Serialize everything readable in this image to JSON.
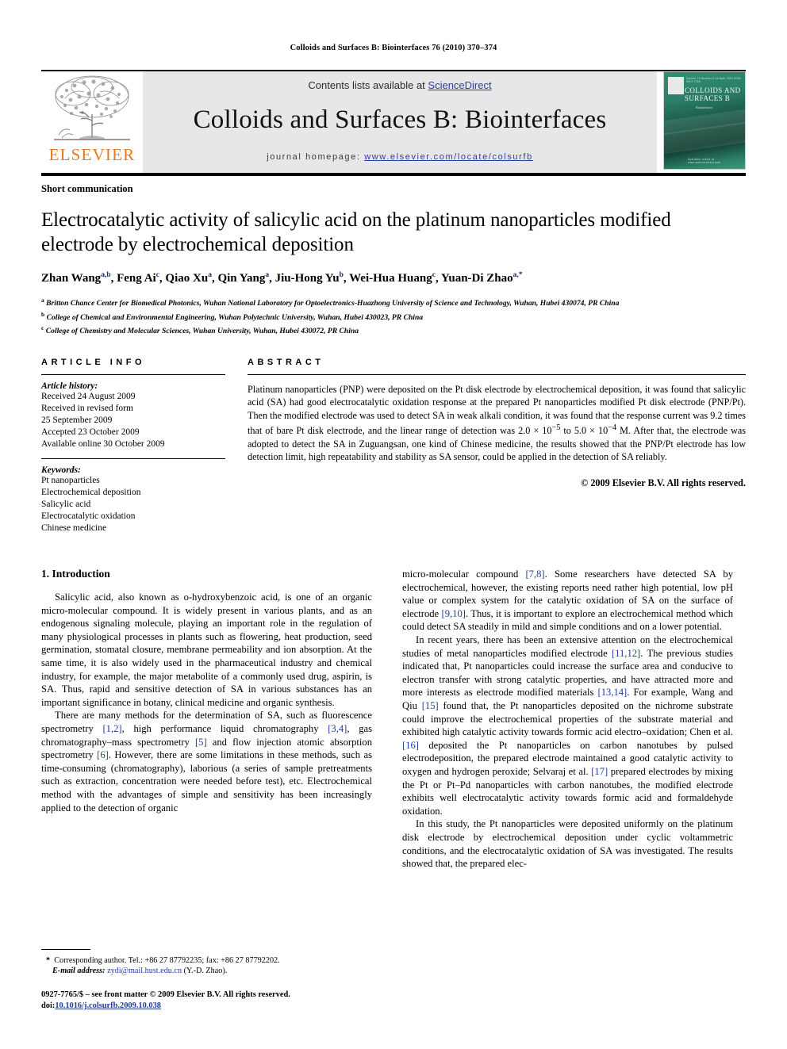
{
  "running_head": "Colloids and Surfaces B: Biointerfaces 76 (2010) 370–374",
  "masthead": {
    "contents_prefix": "Contents lists available at ",
    "sciencedirect": "ScienceDirect",
    "journal_title": "Colloids and Surfaces B: Biointerfaces",
    "homepage_prefix": "journal homepage: ",
    "homepage_url": "www.elsevier.com/locate/colsurfb",
    "publisher_wordmark": "ELSEVIER",
    "cover": {
      "top_line": "Volume 76  Number 2  15 April 2010  ISSN 0927-7765",
      "title": "COLLOIDS AND SURFACES B",
      "subtitle": "Biointerfaces",
      "footer": "Available online at www.sciencedirect.com"
    },
    "colors": {
      "link": "#2b3f9e",
      "elsevier_orange": "#E87722",
      "cover_green": "#2f8f74",
      "masthead_bg": "#e7e7e9"
    }
  },
  "article": {
    "type_label": "Short communication",
    "title": "Electrocatalytic activity of salicylic acid on the platinum nanoparticles modified electrode by electrochemical deposition",
    "authors_html": "Zhan Wang<sup>a,b</sup>, Feng Ai<sup>c</sup>, Qiao Xu<sup>a</sup>, Qin Yang<sup>a</sup>, Jiu-Hong Yu<sup>b</sup>, Wei-Hua Huang<sup>c</sup>, Yuan-Di Zhao<sup>a,</sup><sup>*</sup>",
    "affiliations": [
      "Britton Chance Center for Biomedical Photonics, Wuhan National Laboratory for Optoelectronics-Huazhong University of Science and Technology, Wuhan, Hubei 430074, PR China",
      "College of Chemical and Environmental Engineering, Wuhan Polytechnic University, Wuhan, Hubei 430023, PR China",
      "College of Chemistry and Molecular Sciences, Wuhan University, Wuhan, Hubei 430072, PR China"
    ],
    "affiliation_marks": [
      "a",
      "b",
      "c"
    ]
  },
  "info": {
    "label": "ARTICLE INFO",
    "history_head": "Article history:",
    "history_lines": [
      "Received 24 August 2009",
      "Received in revised form",
      "25 September 2009",
      "Accepted 23 October 2009",
      "Available online 30 October 2009"
    ],
    "keywords_head": "Keywords:",
    "keywords": [
      "Pt nanoparticles",
      "Electrochemical deposition",
      "Salicylic acid",
      "Electrocatalytic oxidation",
      "Chinese medicine"
    ]
  },
  "abstract": {
    "label": "ABSTRACT",
    "text_html": "Platinum nanoparticles (PNP) were deposited on the Pt disk electrode by electrochemical deposition, it was found that salicylic acid (SA) had good electrocatalytic oxidation response at the prepared Pt nanoparticles modified Pt disk electrode (PNP/Pt). Then the modified electrode was used to detect SA in weak alkali condition, it was found that the response current was 9.2 times that of bare Pt disk electrode, and the linear range of detection was 2.0 &times; 10<sup>&minus;5</sup> to 5.0 &times; 10<sup>&minus;4</sup> M. After that, the electrode was adopted to detect the SA in Zuguangsan, one kind of Chinese medicine, the results showed that the PNP/Pt electrode has low detection limit, high repeatability and stability as SA sensor, could be applied in the detection of SA reliably.",
    "copyright": "© 2009 Elsevier B.V. All rights reserved."
  },
  "body": {
    "section_number_title": "1. Introduction",
    "left_paragraphs_html": [
      "Salicylic acid, also known as o-hydroxybenzoic acid, is one of an organic micro-molecular compound. It is widely present in various plants, and as an endogenous signaling molecule, playing an important role in the regulation of many physiological processes in plants such as flowering, heat production, seed germination, stomatal closure, membrane permeability and ion absorption. At the same time, it is also widely used in the pharmaceutical industry and chemical industry, for example, the major metabolite of a commonly used drug, aspirin, is SA. Thus, rapid and sensitive detection of SA in various substances has an important significance in botany, clinical medicine and organic synthesis.",
      "There are many methods for the determination of SA, such as fluorescence spectrometry <span class=\"ref\">[1,2]</span>, high performance liquid chromatography <span class=\"ref\">[3,4]</span>, gas chromatography&ndash;mass spectrometry <span class=\"ref\">[5]</span> and flow injection atomic absorption spectrometry <span class=\"ref\">[6]</span>. However, there are some limitations in these methods, such as time-consuming (chromatography), laborious (a series of sample pretreatments such as extraction, concentration were needed before test), etc. Electrochemical method with the advantages of simple and sensitivity has been increasingly applied to the detection of organic"
    ],
    "right_paragraphs_html": [
      "micro-molecular compound <span class=\"ref\">[7,8]</span>. Some researchers have detected SA by electrochemical, however, the existing reports need rather high potential, low pH value or complex system for the catalytic oxidation of SA on the surface of electrode <span class=\"ref\">[9,10]</span>. Thus, it is important to explore an electrochemical method which could detect SA steadily in mild and simple conditions and on a lower potential.",
      "In recent years, there has been an extensive attention on the electrochemical studies of metal nanoparticles modified electrode <span class=\"ref\">[11,12]</span>. The previous studies indicated that, Pt nanoparticles could increase the surface area and conducive to electron transfer with strong catalytic properties, and have attracted more and more interests as electrode modified materials <span class=\"ref\">[13,14]</span>. For example, Wang and Qiu <span class=\"ref\">[15]</span> found that, the Pt nanoparticles deposited on the nichrome substrate could improve the electrochemical properties of the substrate material and exhibited high catalytic activity towards formic acid electro&ndash;oxidation; Chen et al. <span class=\"ref\">[16]</span> deposited the Pt nanoparticles on carbon nanotubes by pulsed electrodeposition, the prepared electrode maintained a good catalytic activity to oxygen and hydrogen peroxide; Selvaraj et al. <span class=\"ref\">[17]</span> prepared electrodes by mixing the Pt or Pt&ndash;Pd nanoparticles with carbon nanotubes, the modified electrode exhibits well electrocatalytic activity towards formic acid and formaldehyde oxidation.",
      "In this study, the Pt nanoparticles were deposited uniformly on the platinum disk electrode by electrochemical deposition under cyclic voltammetric conditions, and the electrocatalytic oxidation of SA was investigated. The results showed that, the prepared elec-"
    ]
  },
  "footnotes": {
    "corresponding_html": "<span class=\"fn-star\">*</span>&nbsp; Corresponding author. Tel.: +86 27 87792235; fax: +86 27 87792202.",
    "email_html": "<em>E-mail address:</em> <span class=\"foot-link\">zydi@mail.hust.edu.cn</span> (Y.-D. Zhao).",
    "issn_line": "0927-7765/$ – see front matter © 2009 Elsevier B.V. All rights reserved.",
    "doi_prefix": "doi:",
    "doi_value": "10.1016/j.colsurfb.2009.10.038"
  }
}
